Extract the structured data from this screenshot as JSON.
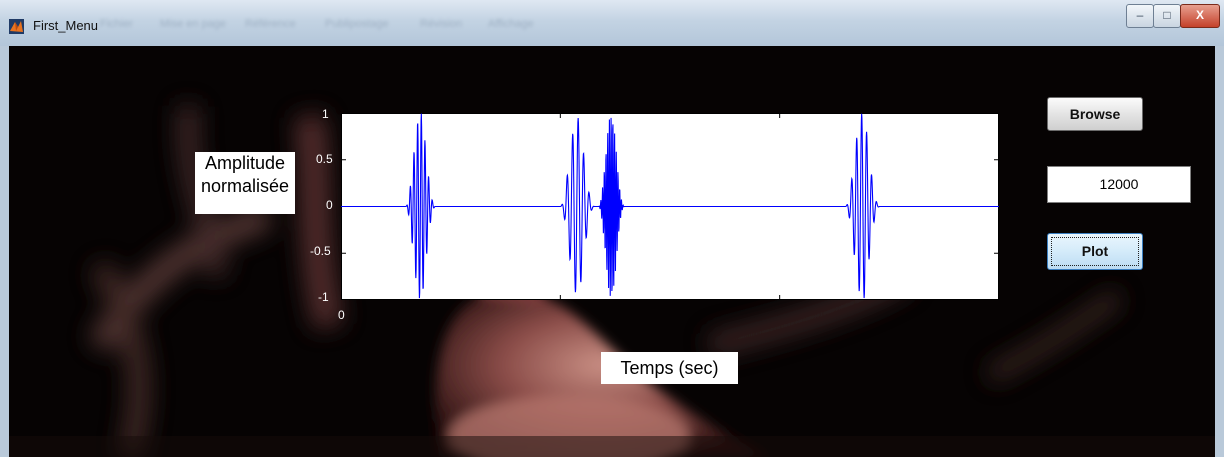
{
  "window": {
    "title": "First_Menu",
    "menu_items": [
      "Fichier",
      "Mise en page",
      "Référence",
      "Publipostage",
      "Révision",
      "Affichage"
    ],
    "controls": {
      "minimize": "–",
      "maximize": "□",
      "close": "X"
    }
  },
  "axes_labels": {
    "y_label_line1": "Amplitude",
    "y_label_line2": "normalisée",
    "x_label": "Temps (sec)"
  },
  "controls": {
    "browse_label": "Browse",
    "value_field": "12000",
    "plot_label": "Plot"
  },
  "chart_data": {
    "type": "line",
    "xlabel": "Temps (sec)",
    "ylabel": "Amplitude normalisée",
    "ylim": [
      -1,
      1
    ],
    "xlim": [
      0,
      12000
    ],
    "yticks": [
      1,
      0.5,
      0,
      -0.5,
      -1
    ],
    "yticks_text": [
      "1",
      "0.5",
      "0",
      "-0.5",
      "-1"
    ],
    "xticks_text": [
      "0"
    ],
    "grid": false,
    "line_color": "#0000ff",
    "series": [
      {
        "bursts": [
          {
            "start": 1180,
            "end": 2050,
            "peak": 1.0,
            "freq": 13
          },
          {
            "start": 4000,
            "end": 5000,
            "peak": 0.95,
            "freq": 10
          },
          {
            "start": 4700,
            "end": 5450,
            "peak": 1.0,
            "freq": 24
          },
          {
            "start": 9200,
            "end": 10200,
            "peak": 1.0,
            "freq": 11
          }
        ]
      }
    ]
  },
  "colors": {
    "background": "#050303",
    "plot_line": "#0000ff"
  }
}
